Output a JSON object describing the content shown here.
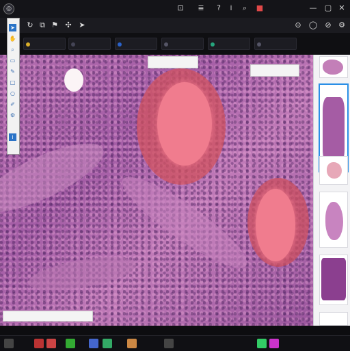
{
  "window": {
    "app_icon": "microscope-icon"
  },
  "toolbar": {
    "tools": [
      "refresh-icon",
      "copy-icon",
      "bookmark-icon",
      "move-icon",
      "pointer-icon",
      "lock-icon",
      "zoom-in-icon",
      "zoom-out-icon"
    ]
  },
  "tabs": [
    {
      "label": "",
      "color": "#d9ae2a"
    },
    {
      "label": "",
      "color": "#444455"
    },
    {
      "label": "",
      "color": "#2a62c9"
    },
    {
      "label": "",
      "color": "#555566"
    },
    {
      "label": "",
      "color": "#26a57d"
    },
    {
      "label": "",
      "color": "#555566"
    }
  ],
  "viewer": {
    "labels": [],
    "colors": {
      "stain_dark": "#9b569e",
      "stain_light": "#c07ab8",
      "lumen": "#f07c8e"
    }
  },
  "left_panel": {
    "items": [
      "arrow-icon",
      "pan-icon",
      "zoom-icon",
      "ruler-icon",
      "annotate-icon",
      "rect-icon",
      "circle-icon",
      "pen-icon",
      "settings-icon",
      "info-icon"
    ]
  },
  "slides": {
    "count": 6,
    "selected_index": 1
  },
  "taskbar": {
    "clock": ""
  },
  "colors": {
    "accent": "#2a8fe6",
    "titlebar": "#141418"
  }
}
